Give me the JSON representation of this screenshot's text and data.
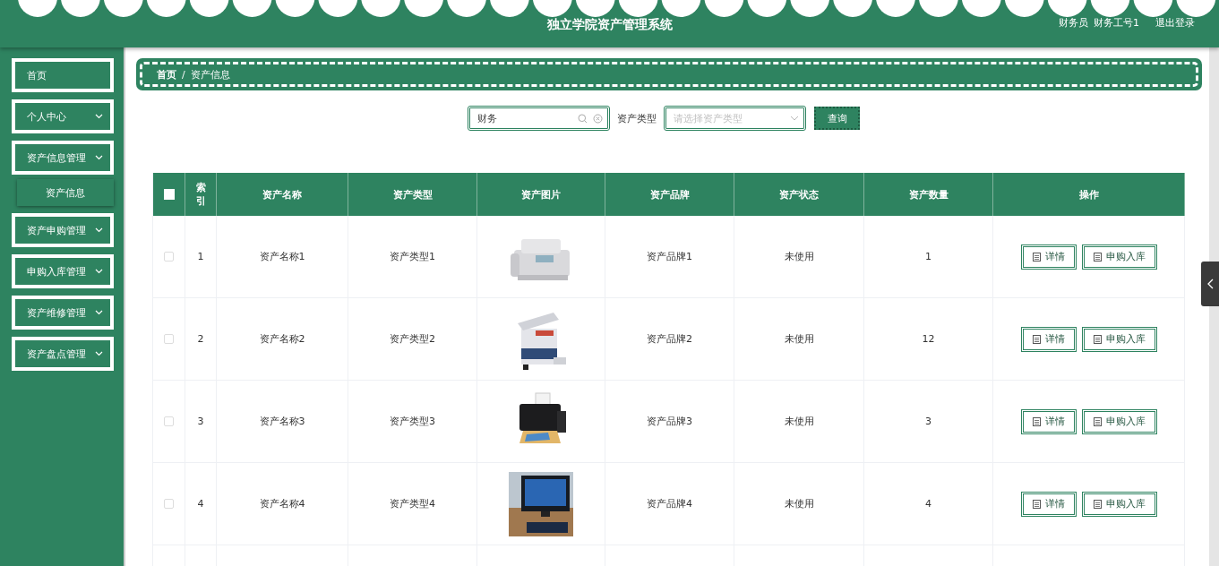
{
  "header": {
    "title": "独立学院资产管理系统",
    "role": "财务员",
    "user": "财务工号1",
    "logout": "退出登录"
  },
  "sidebar": {
    "items": [
      {
        "label": "首页",
        "kind": "link"
      },
      {
        "label": "个人中心",
        "kind": "menu"
      },
      {
        "label": "资产信息管理",
        "kind": "menu",
        "children": [
          {
            "label": "资产信息",
            "selected": true
          }
        ]
      },
      {
        "label": "资产申购管理",
        "kind": "menu"
      },
      {
        "label": "申购入库管理",
        "kind": "menu"
      },
      {
        "label": "资产维修管理",
        "kind": "menu"
      },
      {
        "label": "资产盘点管理",
        "kind": "menu"
      }
    ]
  },
  "breadcrumb": [
    "首页",
    "/",
    "资产信息"
  ],
  "search": {
    "value": "财务",
    "type_label": "资产类型",
    "type_placeholder": "请选择资产类型",
    "button": "查询"
  },
  "table": {
    "header_checked": false,
    "columns": [
      "索引",
      "资产名称",
      "资产类型",
      "资产图片",
      "资产品牌",
      "资产状态",
      "资产数量",
      "操作"
    ],
    "rows": [
      {
        "checked": false,
        "index": "1",
        "name": "资产名称1",
        "type": "资产类型1",
        "brand": "资产品牌1",
        "status": "未使用",
        "quantity": "1",
        "actions": [
          "详情",
          "申购入库"
        ]
      },
      {
        "checked": false,
        "index": "2",
        "name": "资产名称2",
        "type": "资产类型2",
        "brand": "资产品牌2",
        "status": "未使用",
        "quantity": "12",
        "actions": [
          "详情",
          "申购入库"
        ]
      },
      {
        "checked": false,
        "index": "3",
        "name": "资产名称3",
        "type": "资产类型3",
        "brand": "资产品牌3",
        "status": "未使用",
        "quantity": "3",
        "actions": [
          "详情",
          "申购入库"
        ]
      },
      {
        "checked": false,
        "index": "4",
        "name": "资产名称4",
        "type": "资产类型4",
        "brand": "资产品牌4",
        "status": "未使用",
        "quantity": "4",
        "actions": [
          "详情",
          "申购入库"
        ]
      }
    ]
  }
}
